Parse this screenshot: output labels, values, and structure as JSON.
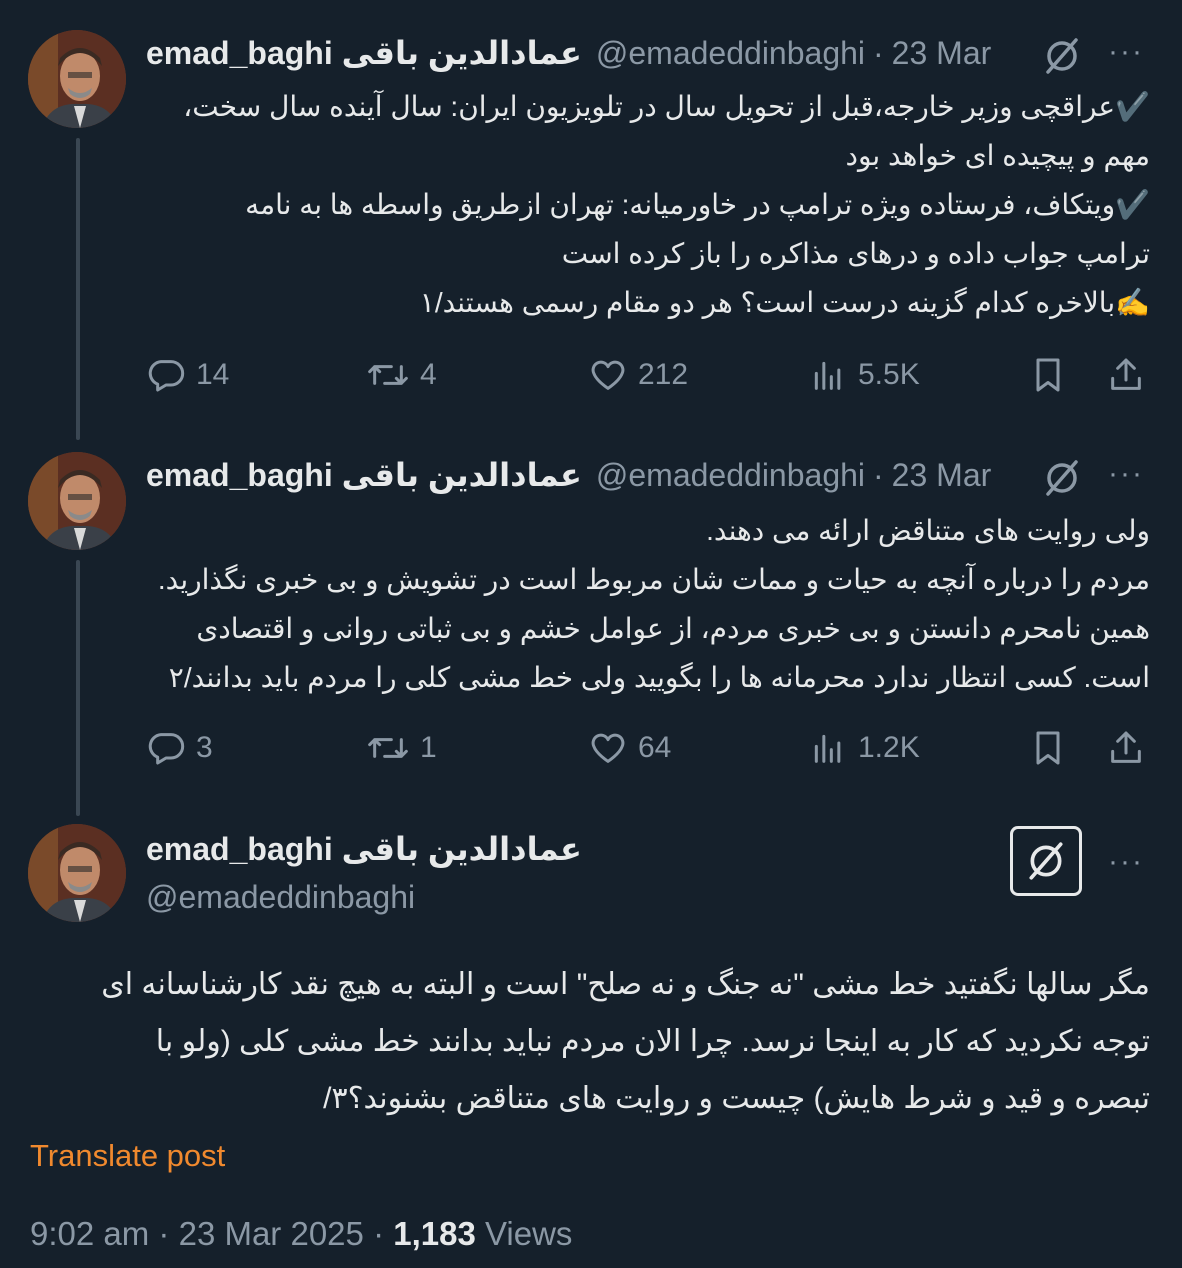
{
  "author": {
    "name": "emad_baghi عمادالدین باقی",
    "handle": "@emadeddinbaghi"
  },
  "icons": {
    "grok": "grok-icon",
    "more": "more-icon",
    "reply": "reply-icon",
    "repost": "repost-icon",
    "like": "like-icon",
    "views": "views-icon",
    "bookmark": "bookmark-icon",
    "share": "share-icon"
  },
  "tweets": [
    {
      "date": "23 Mar",
      "lines": [
        "✔️عراقچی وزیر خارجه،قبل از تحویل سال در تلویزیون ایران: سال آینده سال سخت،",
        "مهم و پیچیده ای خواهد بود",
        "✔️ویتکاف، فرستاده ویژه ترامپ در خاورمیانه: تهران ازطریق واسطه ها به نامه",
        "ترامپ جواب داده و درهای مذاکره را باز کرده است",
        "✍️بالاخره کدام گزینه درست است؟ هر دو مقام رسمی هستند/۱"
      ],
      "replies": "14",
      "reposts": "4",
      "likes": "212",
      "views": "5.5K"
    },
    {
      "date": "23 Mar",
      "lines": [
        "ولی روایت های متناقض ارائه می دهند.",
        "مردم را درباره آنچه به حیات و ممات شان مربوط است در تشویش و بی خبری نگذارید.",
        "همین نامحرم دانستن و بی خبری مردم، از عوامل خشم و بی ثباتی روانی و اقتصادی",
        "است. کسی انتظار ندارد محرمانه ها را بگویید ولی خط مشی کلی را مردم باید بدانند/۲"
      ],
      "replies": "3",
      "reposts": "1",
      "likes": "64",
      "views": "1.2K"
    }
  ],
  "main_tweet": {
    "lines": [
      "مگر سالها نگفتید خط مشی \"نه جنگ و نه صلح\" است و البته به هیچ نقد کارشناسانه ای",
      "توجه نکردید که کار به اینجا نرسد. چرا الان مردم نباید بدانند خط مشی کلی (ولو با",
      "تبصره و قید و شرط هایش) چیست و روایت های متناقض بشنوند؟۳/"
    ],
    "translate_label": "Translate post",
    "time": "9:02 am",
    "full_date": "23 Mar 2025",
    "views_count": "1,183",
    "views_label": "Views"
  }
}
